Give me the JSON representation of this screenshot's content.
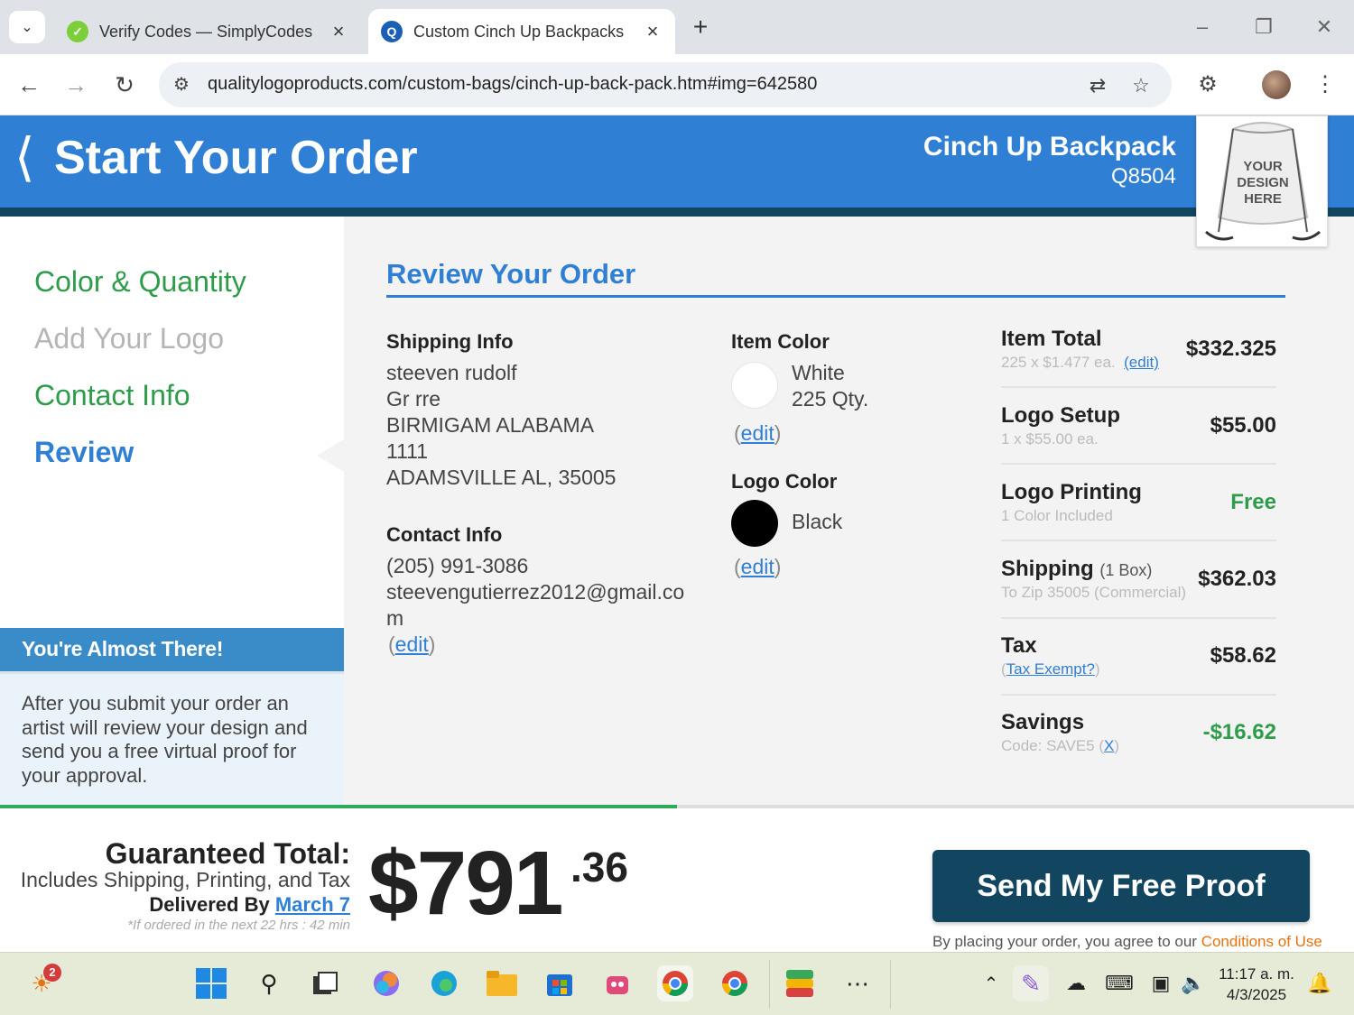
{
  "browser": {
    "tabs": [
      {
        "title": "Verify Codes — SimplyCodes",
        "favicon": "simplycodes-icon",
        "active": false
      },
      {
        "title": "Custom Cinch Up Backpacks",
        "favicon": "qlp-icon",
        "active": true
      }
    ],
    "url": "qualitylogoproducts.com/custom-bags/cinch-up-back-pack.htm#img=642580"
  },
  "header": {
    "title": "Start Your Order",
    "product_name": "Cinch Up Backpack",
    "product_sku": "Q8504",
    "thumb_text_1": "YOUR",
    "thumb_text_2": "DESIGN",
    "thumb_text_3": "HERE"
  },
  "steps": [
    {
      "label": "Color & Quantity",
      "state": "done"
    },
    {
      "label": "Add Your Logo",
      "state": "pending"
    },
    {
      "label": "Contact Info",
      "state": "done"
    },
    {
      "label": "Review",
      "state": "current"
    }
  ],
  "almost": {
    "title": "You're Almost There!",
    "body": "After you submit your order an artist will review your design and send you a free virtual proof for your approval."
  },
  "review": {
    "title": "Review Your Order",
    "shipping": {
      "heading": "Shipping Info",
      "lines": [
        "steeven rudolf",
        "Gr rre",
        "BIRMIGAM ALABAMA",
        "1111",
        "ADAMSVILLE AL, 35005"
      ]
    },
    "contact": {
      "heading": "Contact Info",
      "phone": "(205) 991-3086",
      "email_1": "steevengutierrez2012@gmail.co",
      "email_2": "m",
      "edit": "edit"
    },
    "item_color": {
      "heading": "Item Color",
      "name": "White",
      "qty": "225 Qty.",
      "swatch": "#ffffff",
      "edit": "edit"
    },
    "logo_color": {
      "heading": "Logo Color",
      "name": "Black",
      "swatch": "#000000",
      "edit": "edit"
    }
  },
  "summary": {
    "item_total": {
      "label": "Item Total",
      "sub": "225 x $1.477 ea.",
      "edit": "(edit)",
      "value": "$332.325"
    },
    "logo_setup": {
      "label": "Logo Setup",
      "sub": "1 x $55.00 ea.",
      "value": "$55.00"
    },
    "logo_printing": {
      "label": "Logo Printing",
      "sub": "1 Color Included",
      "value": "Free"
    },
    "shipping": {
      "label": "Shipping",
      "boxes": "(1 Box)",
      "sub": "To Zip 35005 (Commercial)",
      "value": "$362.03"
    },
    "tax": {
      "label": "Tax",
      "link": "Tax Exempt?",
      "value": "$58.62"
    },
    "savings": {
      "label": "Savings",
      "code": "Code: SAVE5",
      "remove": "X",
      "value": "-$16.62"
    }
  },
  "footer": {
    "guaranteed_label": "Guaranteed Total:",
    "includes": "Includes Shipping, Printing, and Tax",
    "delivered_by": "Delivered By",
    "delivery_date": "March 7",
    "note": "*If ordered in the next 22 hrs : 42 min",
    "total_dollars": "$791",
    "total_cents": ".36",
    "progress_fraction": 0.5,
    "send_button": "Send My Free Proof",
    "terms_prefix": "By placing your order, you agree to our",
    "terms_link": "Conditions of Use"
  },
  "taskbar": {
    "widgets_badge": "2",
    "time": "11:17 a. m.",
    "date": "4/3/2025"
  },
  "colors": {
    "brand_blue": "#2f7fd4",
    "dark_navy": "#124560",
    "success_green": "#2e9c4b",
    "link_orange": "#e8720c"
  }
}
